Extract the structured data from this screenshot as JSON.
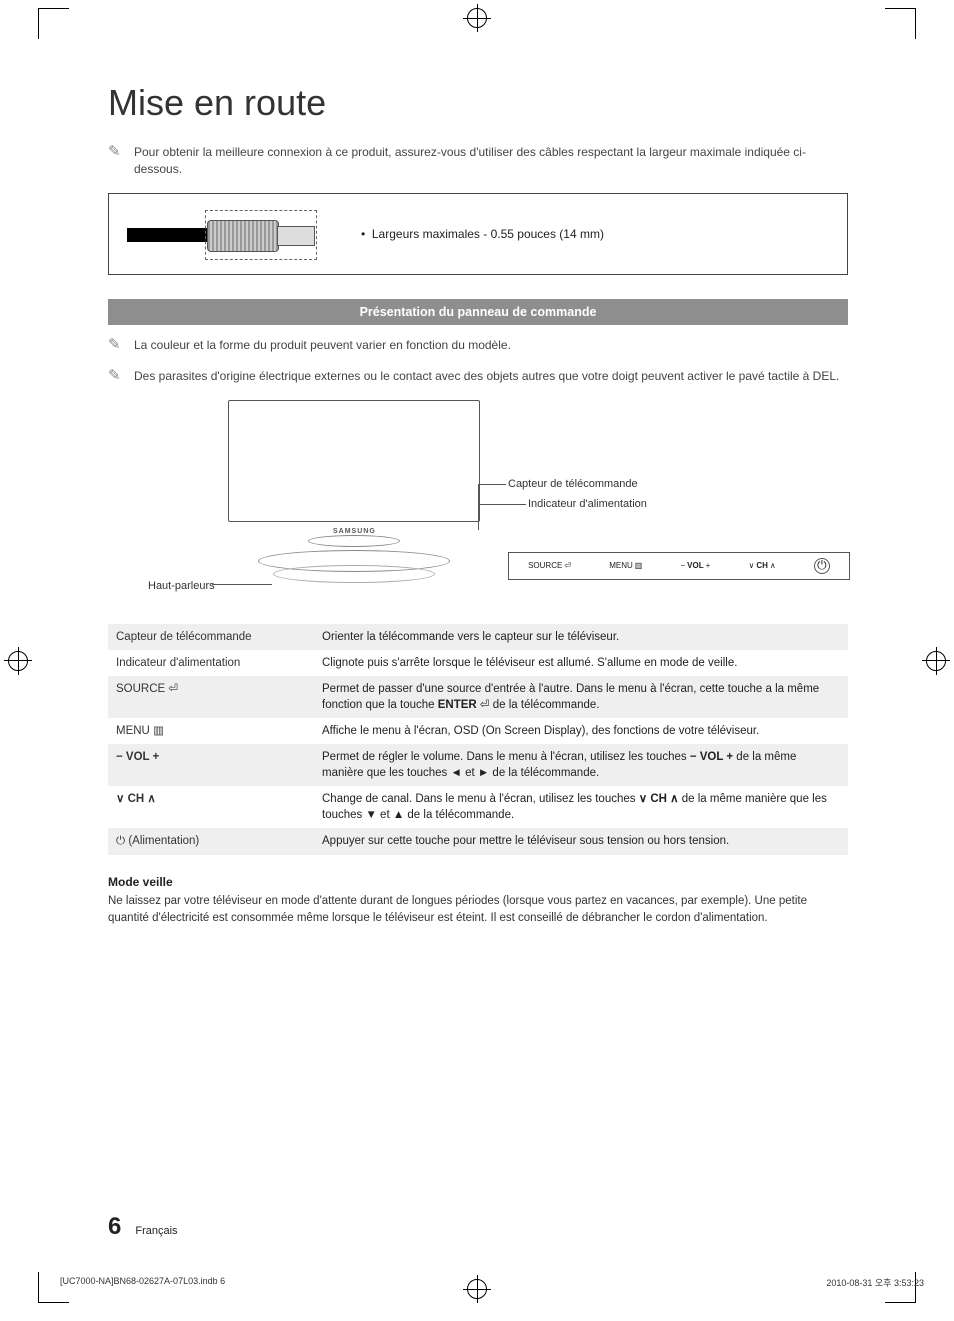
{
  "title": "Mise en route",
  "notes": {
    "cable_intro": "Pour obtenir la meilleure connexion à ce produit, assurez-vous d'utiliser des câbles respectant la largeur maximale indiquée ci-dessous.",
    "color_shape": "La couleur et la forme du produit peuvent varier en fonction du modèle.",
    "parasites": "Des parasites d'origine électrique externes ou le contact avec des objets autres que votre doigt peuvent activer le pavé tactile à DEL."
  },
  "cable": {
    "spec": "Largeurs maximales - 0.55 pouces (14 mm)"
  },
  "section_bar": "Présentation du panneau de commande",
  "figure": {
    "remote_sensor": "Capteur de télécommande",
    "power_indicator": "Indicateur d'alimentation",
    "speakers": "Haut-parleurs",
    "panel": {
      "source": "SOURCE",
      "menu": "MENU",
      "vol": "VOL",
      "ch": "CH"
    }
  },
  "table": [
    {
      "label": "Capteur de télécommande",
      "desc": "Orienter la télécommande vers le capteur sur le téléviseur."
    },
    {
      "label": "Indicateur d'alimentation",
      "desc": "Clignote puis s'arrête lorsque le téléviseur est allumé. S'allume en mode de veille."
    },
    {
      "label": "SOURCE",
      "desc_a": "Permet de passer d'une source d'entrée à l'autre. Dans le menu à l'écran, cette touche a la même fonction que la touche",
      "desc_b": "de la télécommande."
    },
    {
      "label": "MENU",
      "desc": "Affiche le menu à l'écran, OSD (On Screen Display), des fonctions de votre téléviseur."
    },
    {
      "label": "− VOL +",
      "desc_a": "Permet de régler le volume. Dans le menu à l'écran, utilisez les touches",
      "desc_b": "de la même manière que les touches ◄ et ► de la télécommande."
    },
    {
      "label": "∨ CH ∧",
      "desc_a": "Change de canal. Dans le menu à l'écran, utilisez les touches",
      "desc_b": "de la même manière que les touches ▼ et ▲ de la télécommande."
    },
    {
      "label": "(Alimentation)",
      "desc": "Appuyer sur cette touche pour mettre le téléviseur sous tension ou hors tension."
    }
  ],
  "standby": {
    "heading": "Mode veille",
    "body": "Ne laissez par votre téléviseur en mode d'attente durant de longues périodes (lorsque vous partez en vacances, par exemple). Une petite quantité d'électricité est consommée même lorsque le téléviseur est éteint. Il est conseillé de débrancher le cordon d'alimentation."
  },
  "footer": {
    "page": "6",
    "lang": "Français"
  },
  "print": {
    "file": "[UC7000-NA]BN68-02627A-07L03.indb   6",
    "time": "2010-08-31   오후 3:53:23"
  }
}
